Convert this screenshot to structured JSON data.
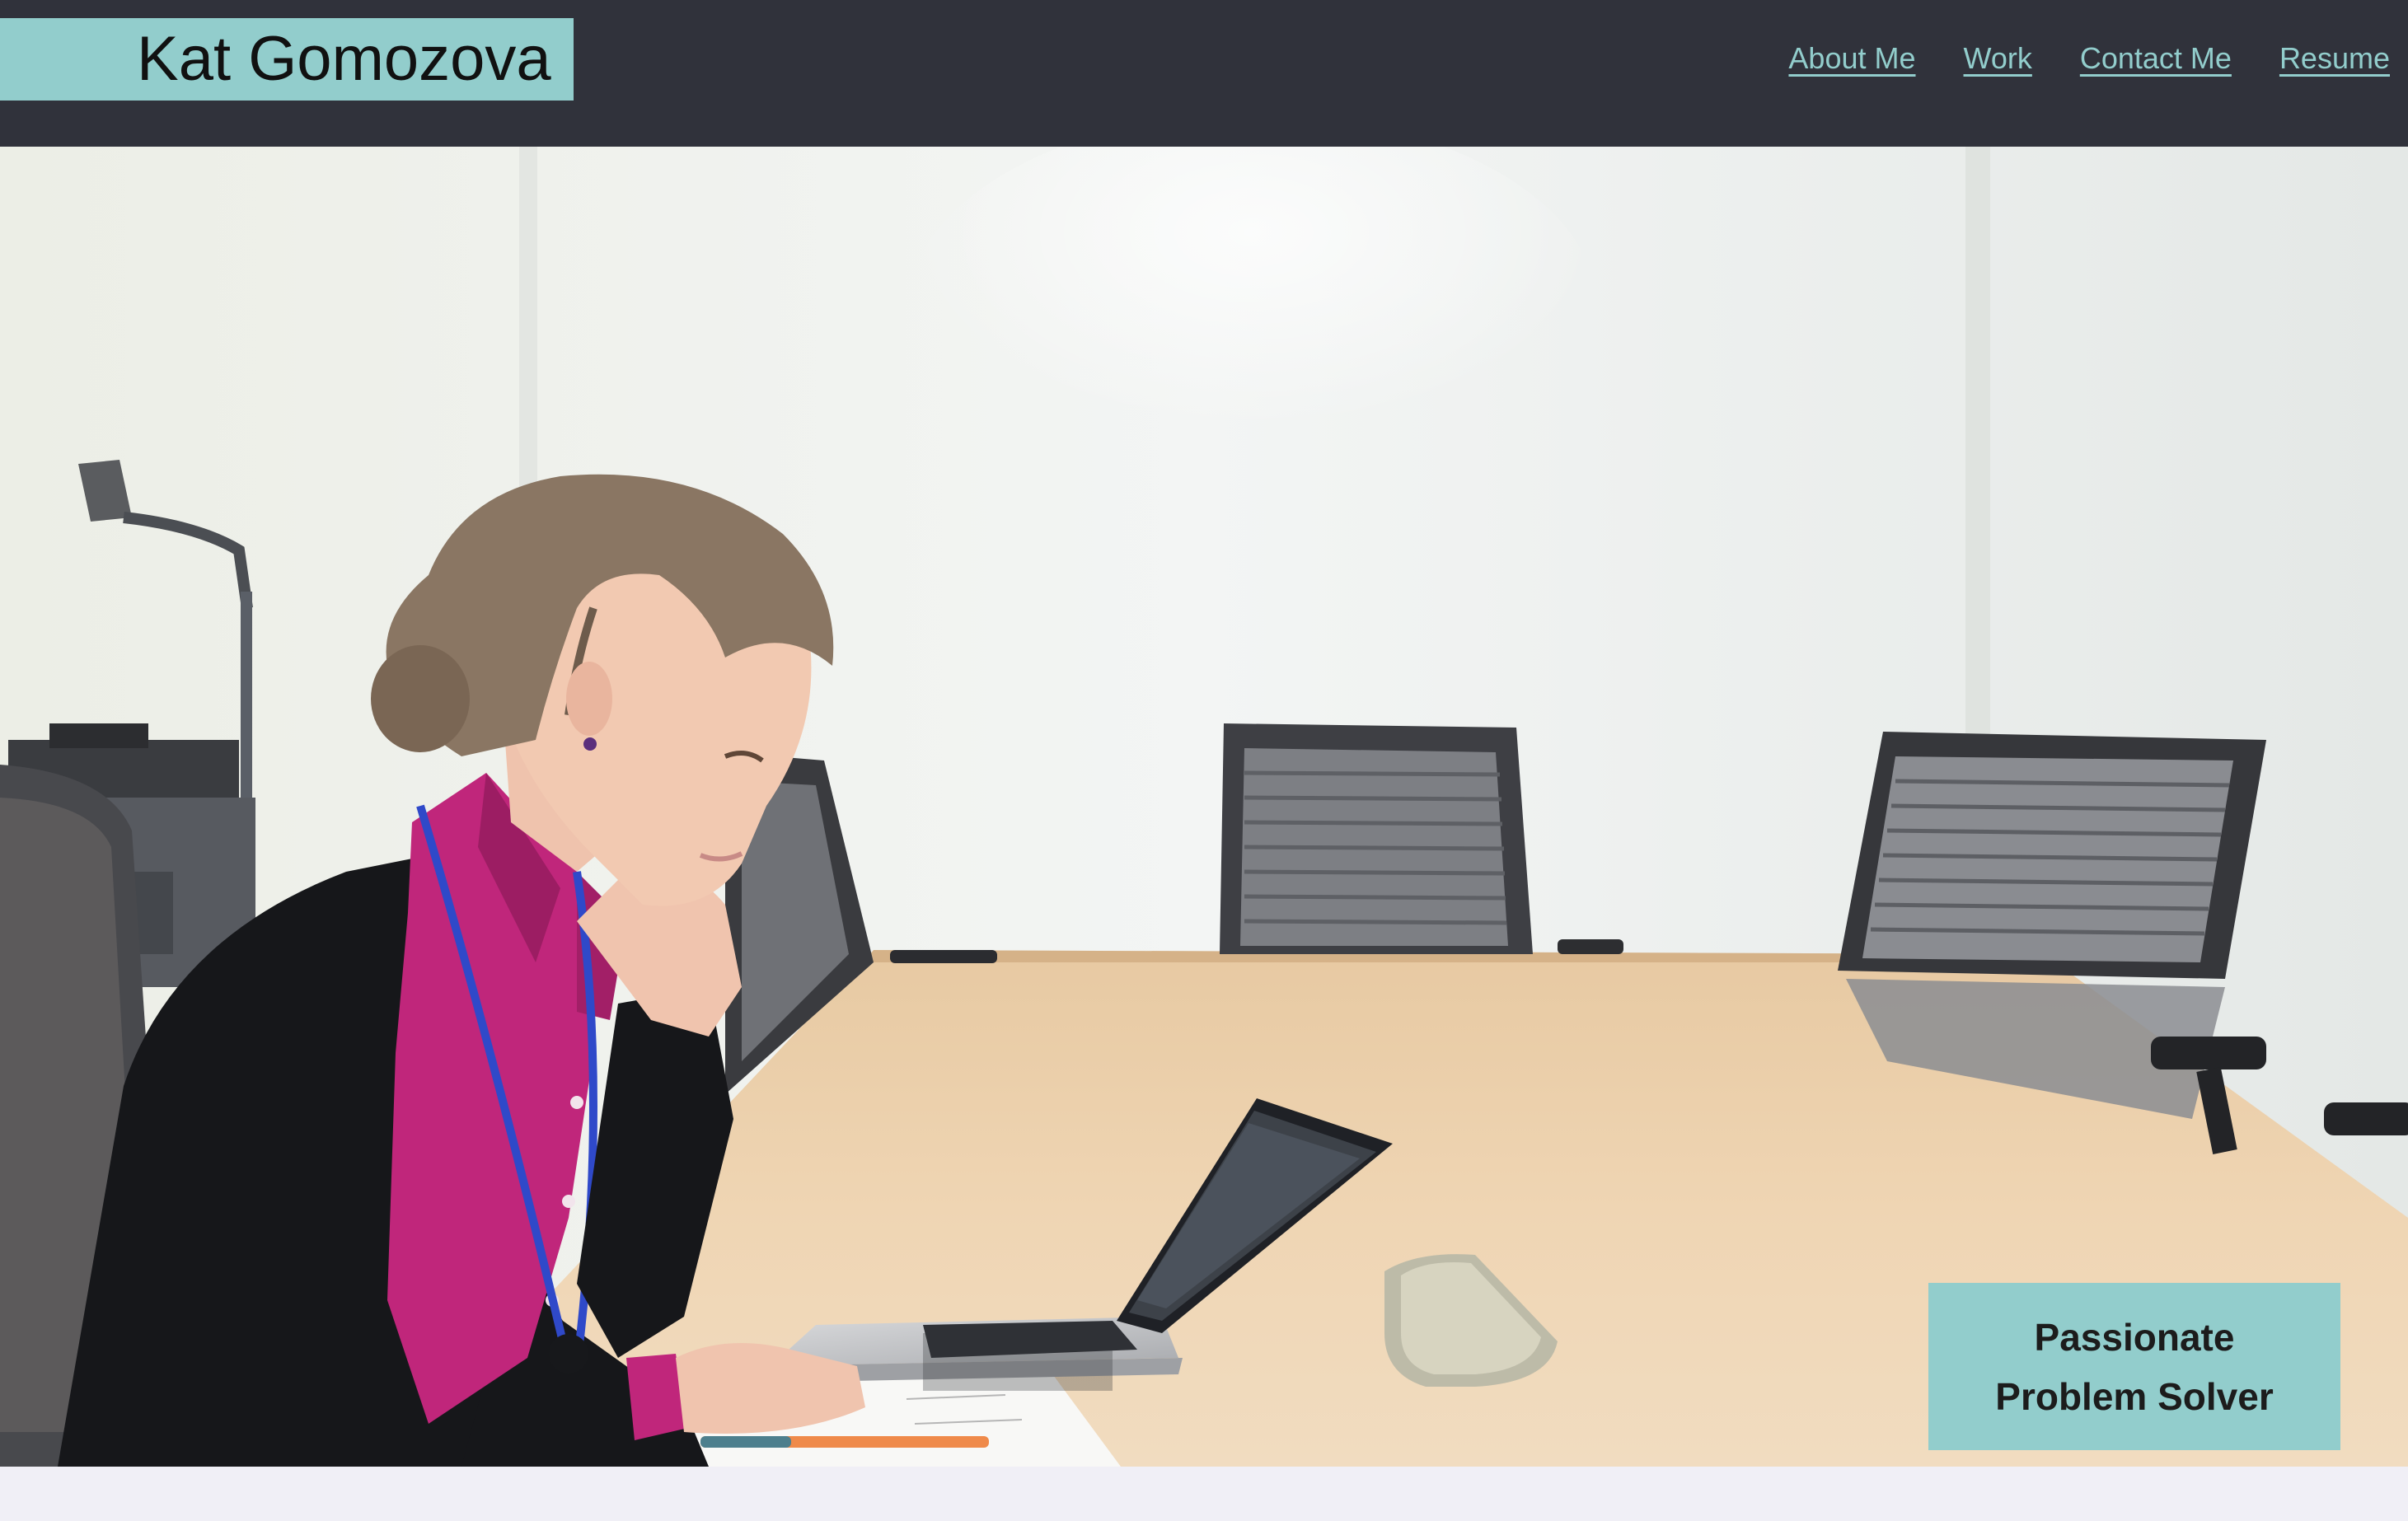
{
  "header": {
    "title": "Kat Gomozova",
    "nav": [
      {
        "label": "About Me"
      },
      {
        "label": "Work"
      },
      {
        "label": "Contact Me"
      },
      {
        "label": "Resume"
      }
    ]
  },
  "hero": {
    "image": "woman-working-on-laptop-in-conference-room",
    "tagline_line1": "Passionate",
    "tagline_line2": "Problem Solver"
  },
  "colors": {
    "header_bg": "#30323b",
    "accent": "#92cdcc",
    "page_bg": "#f0eff6"
  }
}
